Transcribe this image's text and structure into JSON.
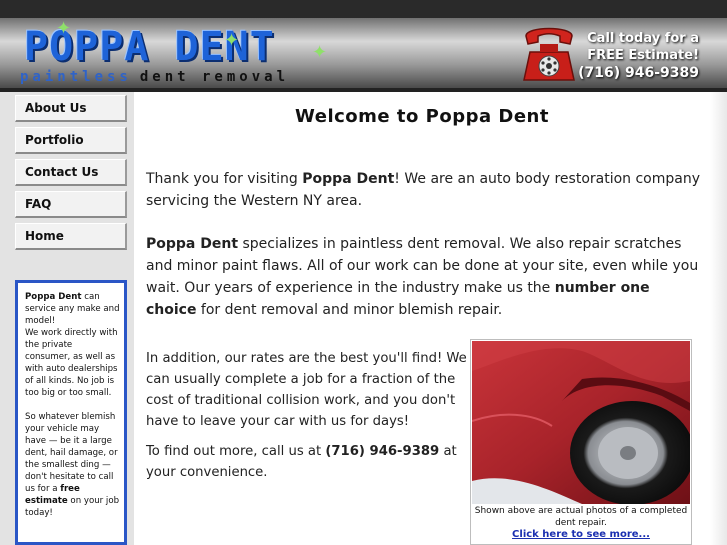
{
  "header": {
    "logo_title": "POPPA DENT",
    "logo_sub_1": "paintless",
    "logo_sub_2": "dent removal",
    "cta_line1": "Call today for a",
    "cta_line2": "FREE Estimate!",
    "cta_phone": "(716) 946-9389",
    "phone_color": "#d0241d"
  },
  "nav": {
    "items": [
      {
        "label": "About Us"
      },
      {
        "label": "Portfolio"
      },
      {
        "label": "Contact Us"
      },
      {
        "label": "FAQ"
      },
      {
        "label": "Home"
      }
    ]
  },
  "promo": {
    "brand": "Poppa Dent",
    "p1_rest": " can service any make and model!",
    "p1_line2": "We work directly with the private consumer, as well as with auto dealerships of all kinds.  No job is too big or too small.",
    "p2_start": "So whatever blemish your vehicle may have — be it a large dent, hail damage, or the smallest ding — don't hesitate to call us for a ",
    "p2_bold": "free estimate",
    "p2_end": " on your job today!",
    "border_color": "#2a56c6"
  },
  "main": {
    "title": "Welcome to Poppa Dent",
    "p1_a": "Thank you for visiting ",
    "p1_bold": "Poppa Dent",
    "p1_b": "! We are an auto body restoration company servicing the Western NY area.",
    "p2_bold1": "Poppa Dent",
    "p2_a": " specializes in paintless dent removal. We also repair scratches and minor paint flaws. All of our work can be done at your site, even while you wait. Our years of experience in the industry make us the ",
    "p2_bold2": "number one choice",
    "p2_b": " for dent removal and minor blemish repair.",
    "p3": "In addition, our rates are the best you'll find! We can usually complete a job for a fraction of the cost of traditional collision work, and you don't have to leave your car with us for days!",
    "p4_a": "To find out more, call us at ",
    "p4_bold": "(716) 946-9389",
    "p4_b": " at your convenience."
  },
  "photo": {
    "caption": "Shown above are actual photos of a completed dent repair.",
    "link": "Click here to see more...",
    "car_color": "#a8232a"
  }
}
